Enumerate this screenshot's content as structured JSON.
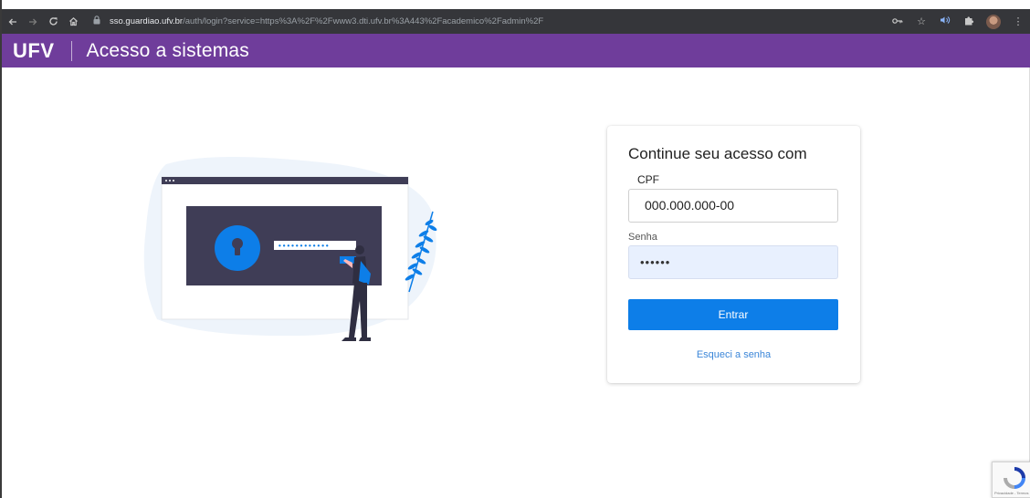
{
  "browser": {
    "url_host": "sso.guardiao.ufv.br",
    "url_path": "/auth/login?service=https%3A%2F%2Fwww3.dti.ufv.br%3A443%2Facademico%2Fadmin%2F"
  },
  "header": {
    "brand": "UFV",
    "title": "Acesso a sistemas",
    "background": "#6f3d9b"
  },
  "illustration": {
    "password_mask": "••••••••••••"
  },
  "login": {
    "heading": "Continue seu acesso com",
    "cpf_label": "CPF",
    "cpf_value": "000.000.000-00",
    "senha_label": "Senha",
    "senha_value": "••••••",
    "submit_label": "Entrar",
    "forgot_label": "Esqueci a senha",
    "accent": "#0d7ee8"
  },
  "recaptcha": {
    "footer": "Privacidade - Termos"
  }
}
